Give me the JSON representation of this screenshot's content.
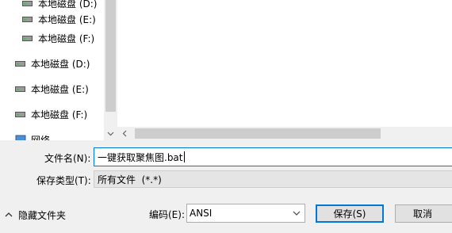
{
  "nav": {
    "items": [
      {
        "label": "本地磁盘 (D:)"
      },
      {
        "label": "本地磁盘 (E:)"
      },
      {
        "label": "本地磁盘 (F:)"
      },
      {
        "label": "本地磁盘 (D:)"
      },
      {
        "label": "本地磁盘 (E:)"
      },
      {
        "label": "本地磁盘 (F:)"
      },
      {
        "label": "网络"
      }
    ]
  },
  "form": {
    "filename_label": "文件名(N):",
    "filename_value": "一键获取聚焦图.bat",
    "filetype_label": "保存类型(T):",
    "filetype_value": "所有文件  (*.*)",
    "encoding_label": "编码(E):",
    "encoding_value": "ANSI"
  },
  "footer": {
    "hide_folders_label": "隐藏文件夹",
    "save_label": "保存(S)",
    "cancel_label": "取消"
  },
  "colors": {
    "accent": "#0078d7",
    "panel_bg": "#f0f0f0",
    "button_bg": "#e1e1e1"
  }
}
